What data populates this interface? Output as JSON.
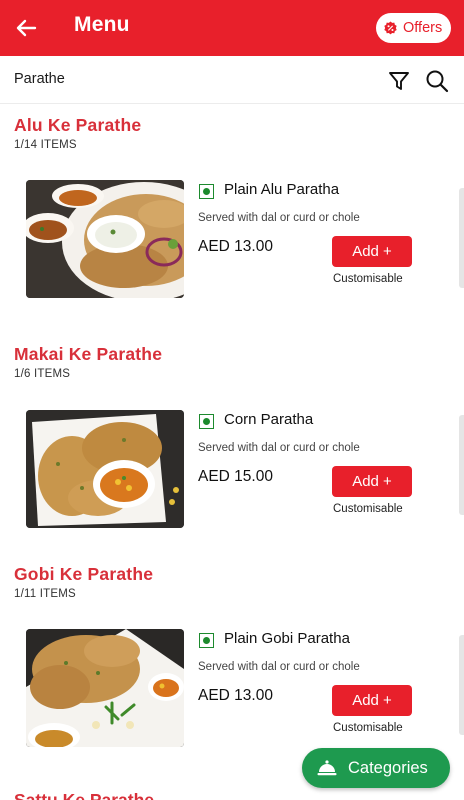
{
  "colors": {
    "brand_red": "#e8202b",
    "section_red": "#d8303a",
    "veg_green": "#1d8a2e",
    "fab_green": "#1e9a4f"
  },
  "header": {
    "title": "Menu",
    "back_icon": "arrow-left-icon",
    "offers_label": "Offers",
    "offers_icon": "discount-badge-icon"
  },
  "subheader": {
    "title": "Parathe",
    "filter_icon": "filter-funnel-icon",
    "search_icon": "search-icon"
  },
  "sections": [
    {
      "title": "Alu Ke Parathe",
      "count": "1/14 ITEMS",
      "item": {
        "name": "Plain Alu Paratha",
        "description": "Served with dal or curd or chole",
        "price": "AED 13.00",
        "add_label": "Add +",
        "custom_label": "Customisable",
        "veg": true
      }
    },
    {
      "title": "Makai Ke Parathe",
      "count": "1/6 ITEMS",
      "item": {
        "name": "Corn Paratha",
        "description": "Served with dal or curd or chole",
        "price": "AED 15.00",
        "add_label": "Add +",
        "custom_label": "Customisable",
        "veg": true
      }
    },
    {
      "title": "Gobi Ke Parathe",
      "count": "1/11 ITEMS",
      "item": {
        "name": "Plain Gobi Paratha",
        "description": "Served with dal or curd or chole",
        "price": "AED 13.00",
        "add_label": "Add +",
        "custom_label": "Customisable",
        "veg": true
      }
    }
  ],
  "partial_section_title": "Sattu Ke Parathe",
  "categories_button": {
    "label": "Categories",
    "icon": "food-cloche-icon"
  }
}
